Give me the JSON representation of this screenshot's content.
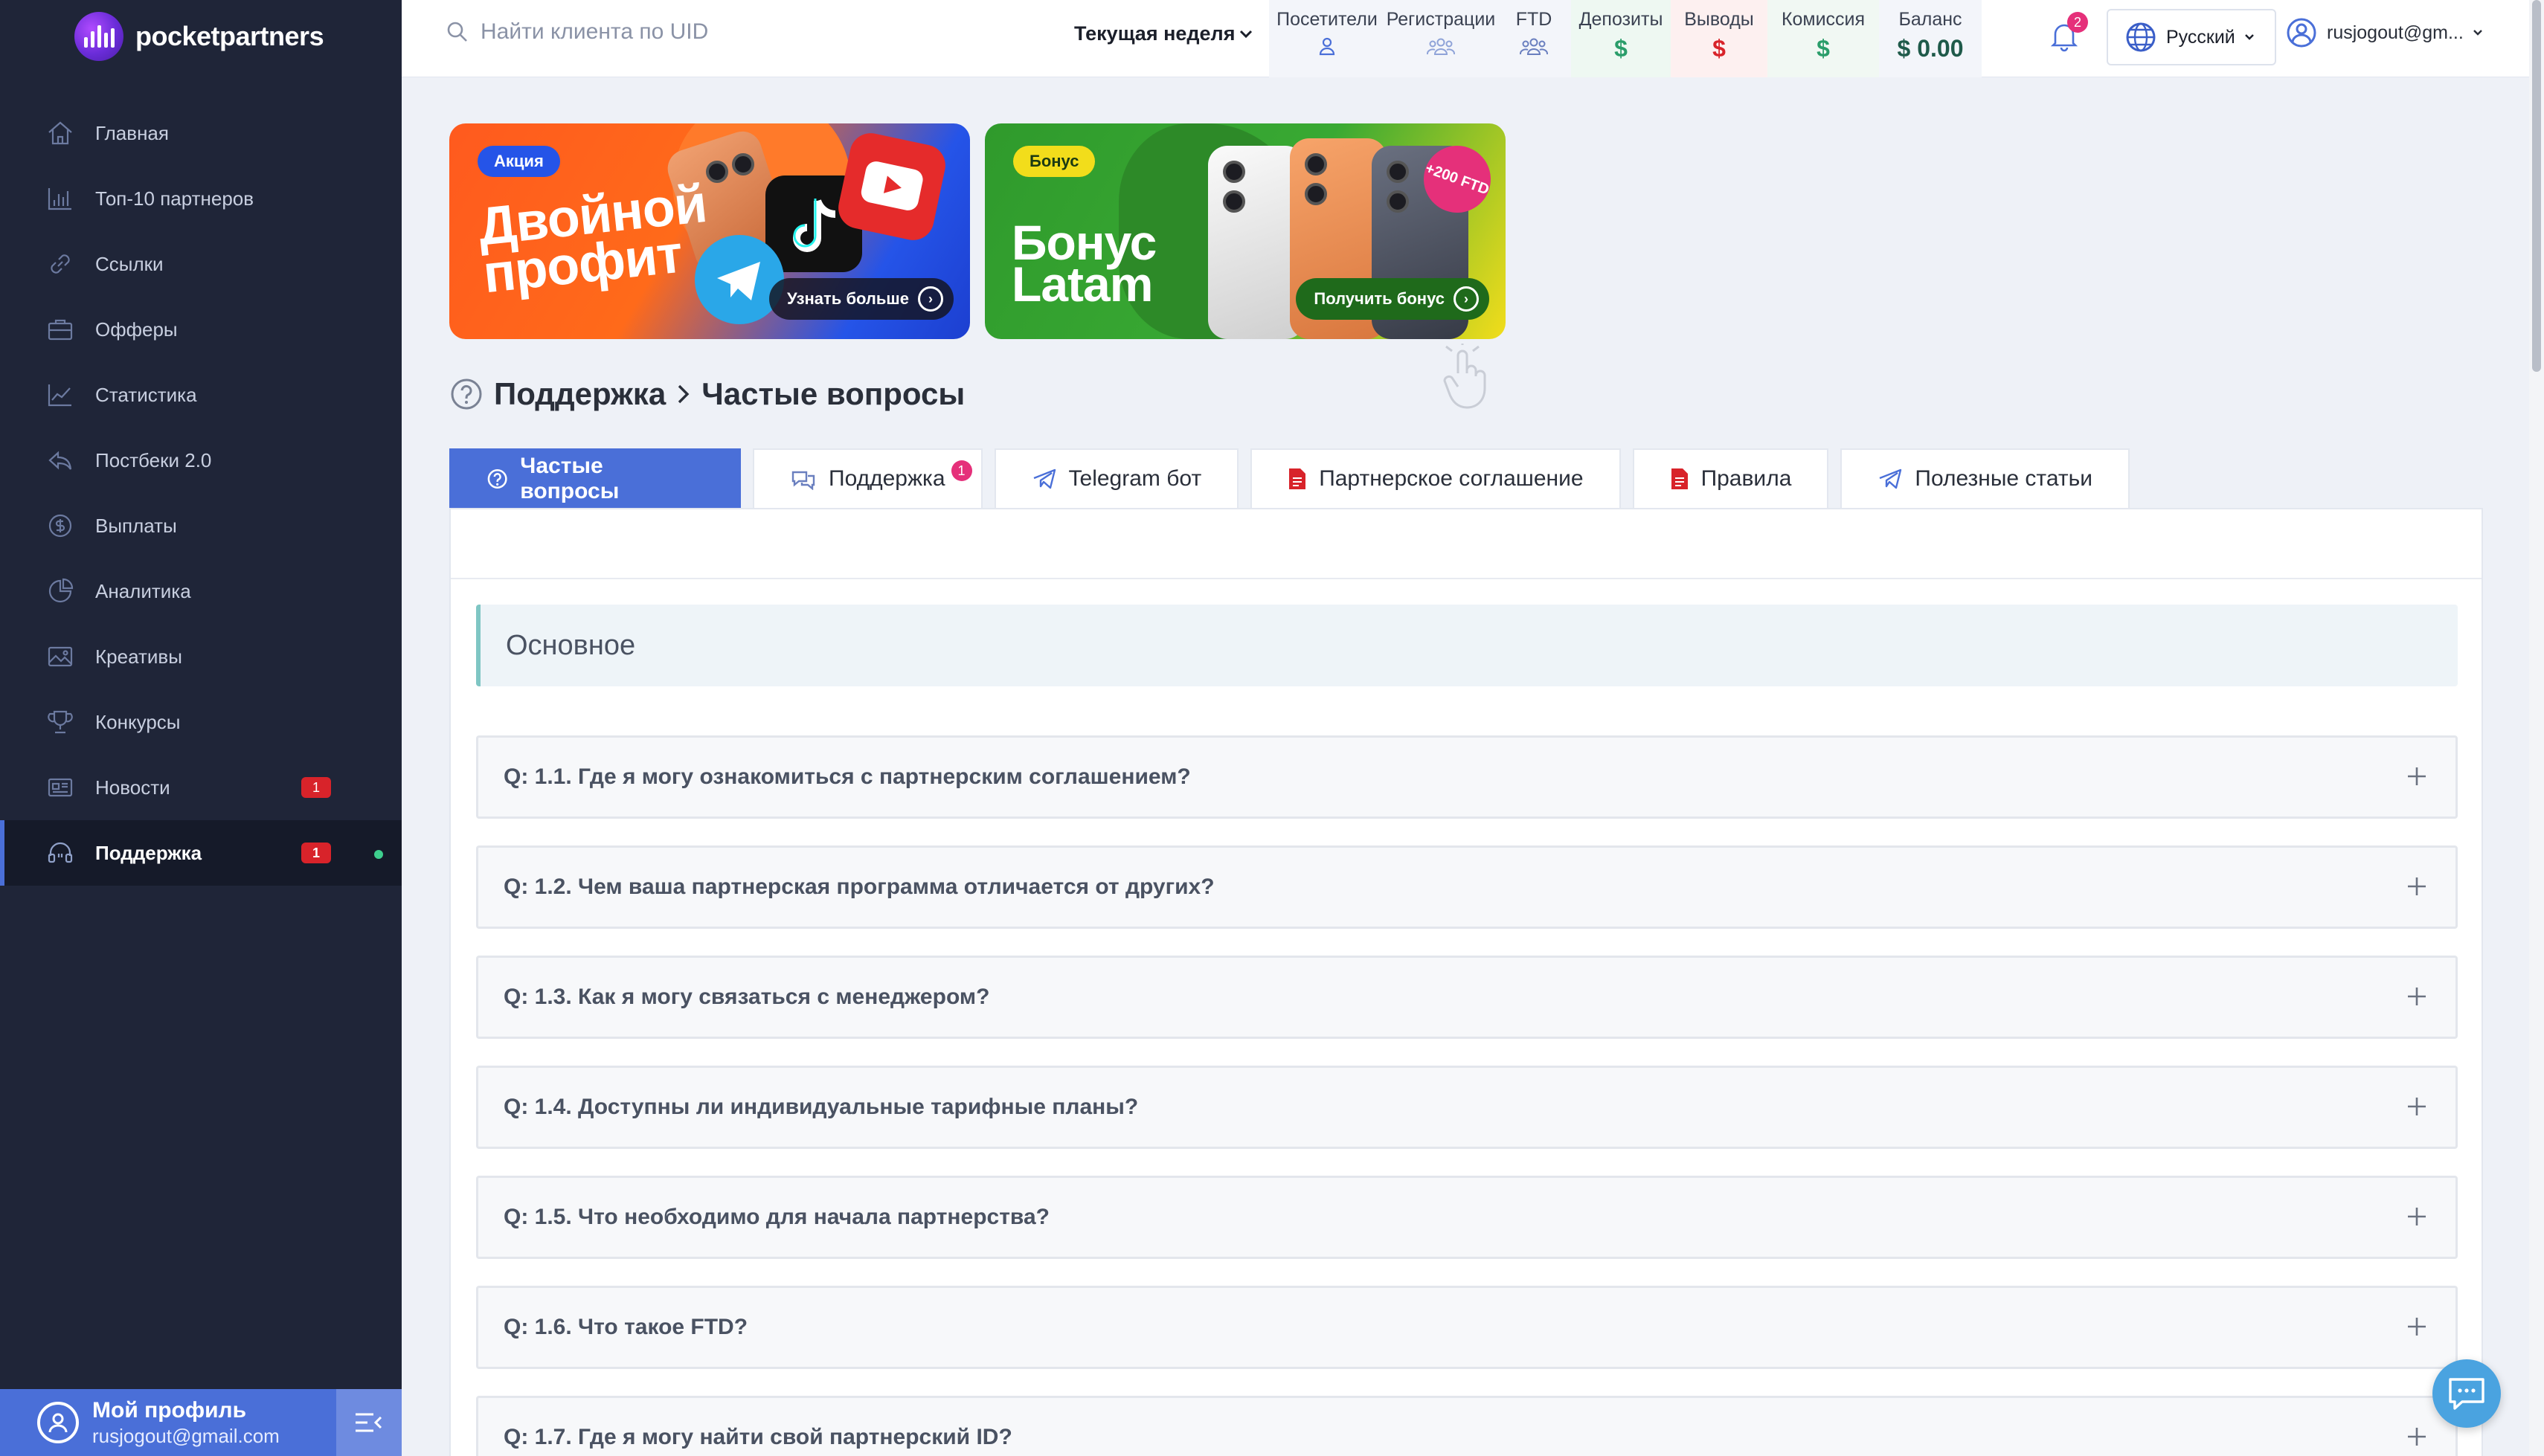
{
  "brand": {
    "name": "pocketpartners"
  },
  "sidebar": {
    "items": [
      {
        "label": "Главная",
        "icon": "home-icon"
      },
      {
        "label": "Топ-10 партнеров",
        "icon": "bar-chart-icon"
      },
      {
        "label": "Ссылки",
        "icon": "link-icon"
      },
      {
        "label": "Офферы",
        "icon": "briefcase-icon"
      },
      {
        "label": "Статистика",
        "icon": "line-chart-icon"
      },
      {
        "label": "Постбеки 2.0",
        "icon": "postback-icon"
      },
      {
        "label": "Выплаты",
        "icon": "dollar-icon"
      },
      {
        "label": "Аналитика",
        "icon": "pie-chart-icon"
      },
      {
        "label": "Креативы",
        "icon": "image-icon"
      },
      {
        "label": "Конкурсы",
        "icon": "trophy-icon"
      },
      {
        "label": "Новости",
        "icon": "news-icon",
        "badge": "1"
      },
      {
        "label": "Поддержка",
        "icon": "headset-icon",
        "badge": "1",
        "active": true
      }
    ],
    "profile": {
      "title": "Мой профиль",
      "email": "rusjogout@gmail.com"
    }
  },
  "topbar": {
    "search_placeholder": "Найти клиента по UID",
    "period": "Текущая неделя",
    "stats": {
      "visitors": {
        "label": "Посетители"
      },
      "registrations": {
        "label": "Регистрации"
      },
      "ftd": {
        "label": "FTD"
      },
      "deposits": {
        "label": "Депозиты",
        "value": "$"
      },
      "withdrawals": {
        "label": "Выводы",
        "value": "$"
      },
      "commission": {
        "label": "Комиссия",
        "value": "$"
      },
      "balance": {
        "label": "Баланс",
        "value": "$ 0.00"
      }
    },
    "notifications_count": "2",
    "language": "Русский",
    "user_email": "rusjogout@gm..."
  },
  "banners": [
    {
      "tag": "Акция",
      "title_line1": "Двойной",
      "title_line2": "профит",
      "cta": "Узнать больше"
    },
    {
      "tag": "Бонус",
      "title_line1": "Бонус",
      "title_line2": "Latam",
      "cta": "Получить бонус",
      "sticker": "+200 FTD"
    }
  ],
  "breadcrumb": {
    "parent": "Поддержка",
    "current": "Частые вопросы"
  },
  "tabs": [
    {
      "label": "Частые вопросы",
      "active": true
    },
    {
      "label": "Поддержка",
      "badge": "1"
    },
    {
      "label": "Telegram бот"
    },
    {
      "label": "Партнерское соглашение"
    },
    {
      "label": "Правила"
    },
    {
      "label": "Полезные статьи"
    }
  ],
  "faq": {
    "section_title": "Основное",
    "questions": [
      "Q: 1.1. Где я могу ознакомиться с партнерским соглашением?",
      "Q: 1.2. Чем ваша партнерская программа отличается от других?",
      "Q: 1.3. Как я могу связаться с менеджером?",
      "Q: 1.4. Доступны ли индивидуальные тарифные планы?",
      "Q: 1.5. Что необходимо для начала партнерства?",
      "Q: 1.6. Что такое FTD?",
      "Q: 1.7. Где я могу найти свой партнерский ID?"
    ]
  },
  "colors": {
    "sidebar_bg": "#1f2538",
    "accent": "#4a6fd8",
    "positive": "#2a9d6a",
    "negative": "#d8232a"
  }
}
